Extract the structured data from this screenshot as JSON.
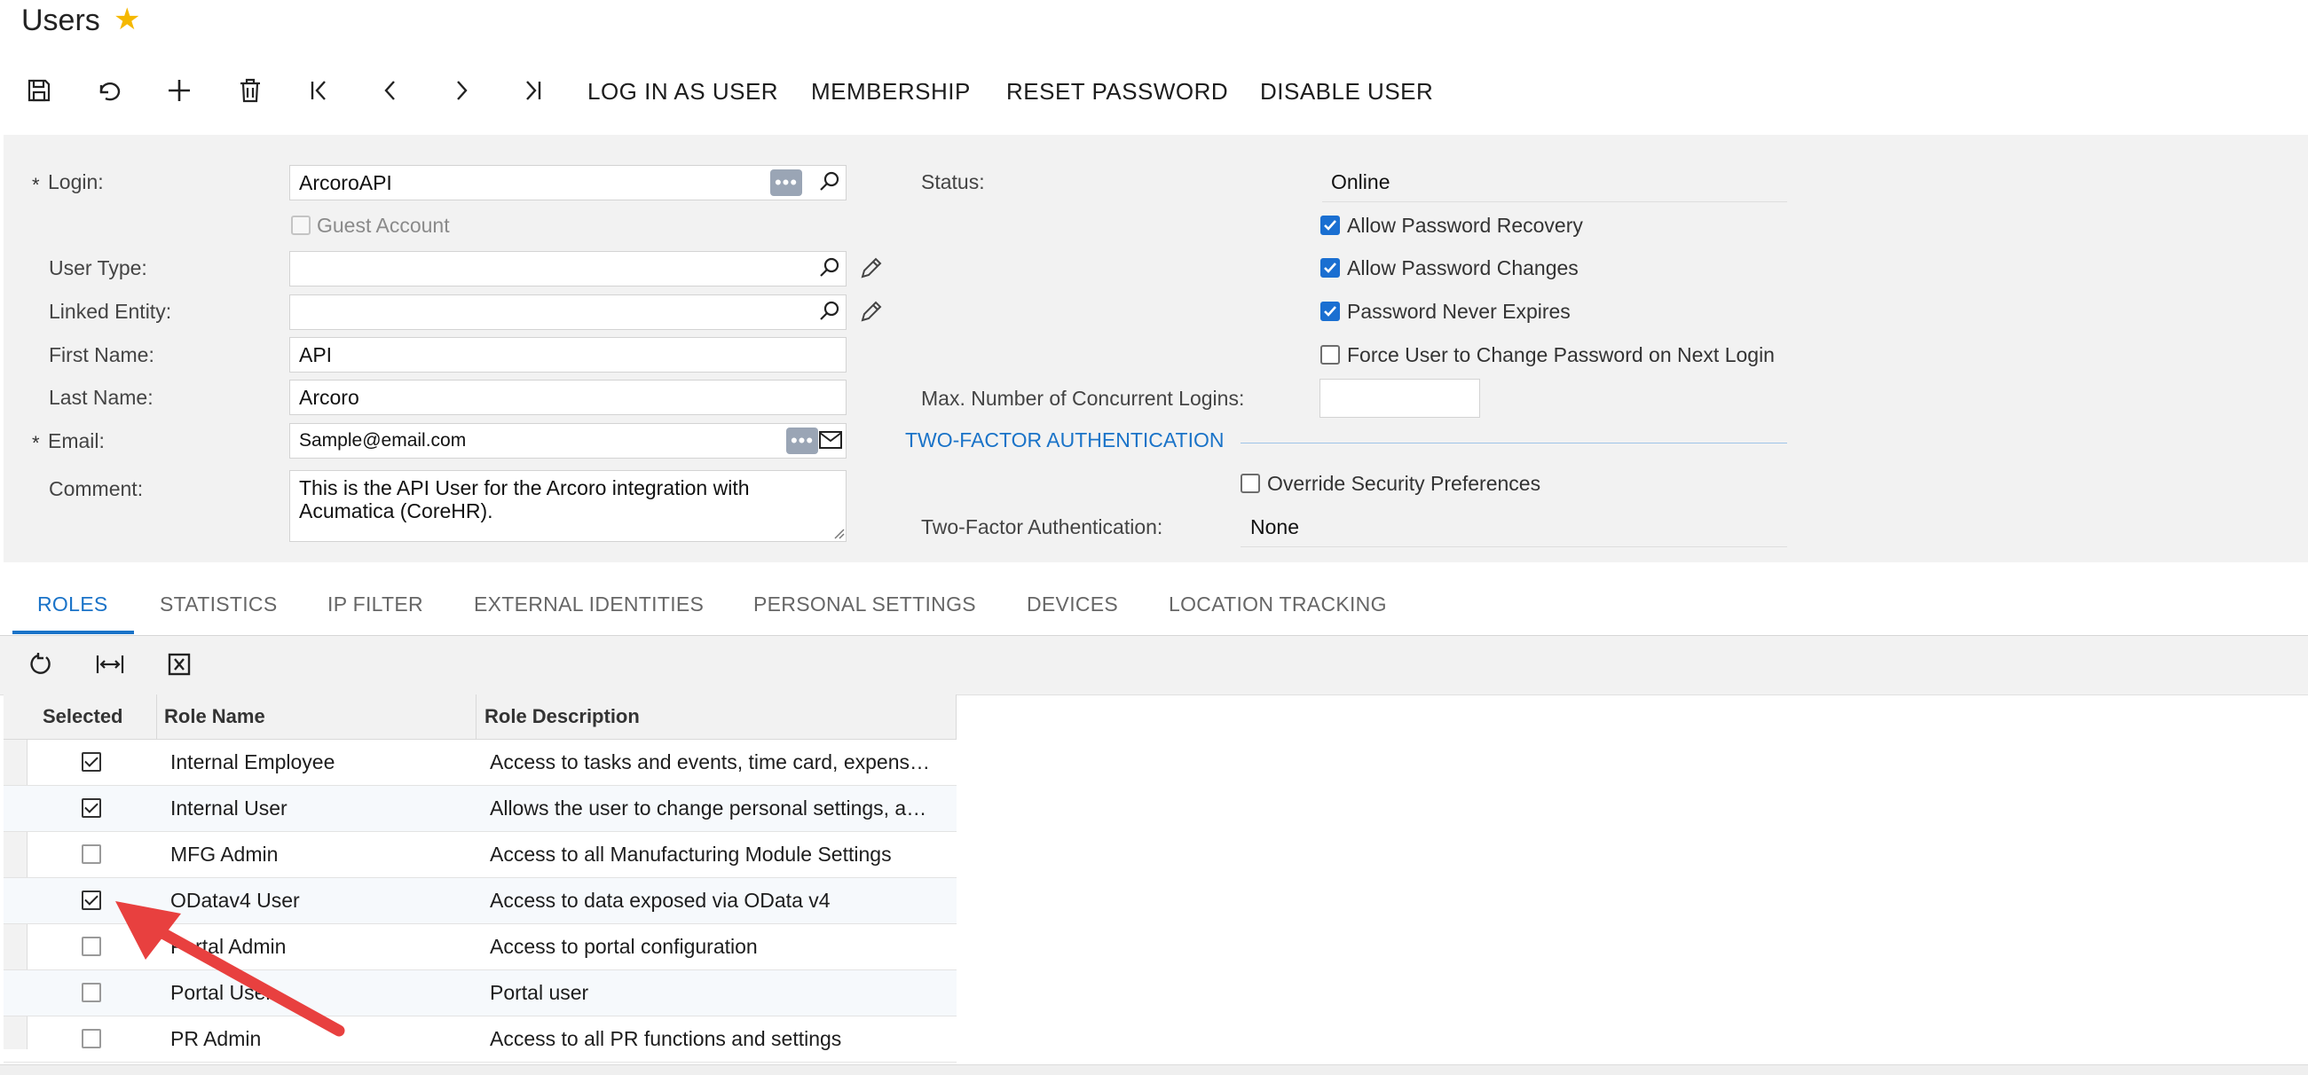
{
  "page": {
    "title": "Users"
  },
  "toolbar": {
    "actions": [
      "LOG IN AS USER",
      "MEMBERSHIP",
      "RESET PASSWORD",
      "DISABLE USER"
    ]
  },
  "form": {
    "login": {
      "label": "Login:",
      "value": "ArcoroAPI"
    },
    "guest_account": {
      "label": "Guest Account",
      "checked": false
    },
    "user_type": {
      "label": "User Type:",
      "value": ""
    },
    "linked_entity": {
      "label": "Linked Entity:",
      "value": ""
    },
    "first_name": {
      "label": "First Name:",
      "value": "API"
    },
    "last_name": {
      "label": "Last Name:",
      "value": "Arcoro"
    },
    "email": {
      "label": "Email:",
      "value": "Sample@email.com"
    },
    "comment": {
      "label": "Comment:",
      "value": "This is the API User for the Arcoro integration with Acumatica (CoreHR)."
    },
    "status": {
      "label": "Status:",
      "value": "Online"
    },
    "allow_password_recovery": {
      "label": "Allow Password Recovery",
      "checked": true
    },
    "allow_password_changes": {
      "label": "Allow Password Changes",
      "checked": true
    },
    "password_never_expires": {
      "label": "Password Never Expires",
      "checked": true
    },
    "force_change": {
      "label": "Force User to Change Password on Next Login",
      "checked": false
    },
    "max_logins": {
      "label": "Max. Number of Concurrent Logins:",
      "value": ""
    },
    "two_factor_section": "TWO-FACTOR AUTHENTICATION",
    "override_security": {
      "label": "Override Security Preferences",
      "checked": false
    },
    "two_factor": {
      "label": "Two-Factor Authentication:",
      "value": "None"
    }
  },
  "tabs": [
    "ROLES",
    "STATISTICS",
    "IP FILTER",
    "EXTERNAL IDENTITIES",
    "PERSONAL SETTINGS",
    "DEVICES",
    "LOCATION TRACKING"
  ],
  "active_tab": "ROLES",
  "grid": {
    "columns": [
      "Selected",
      "Role Name",
      "Role Description"
    ],
    "rows": [
      {
        "selected": true,
        "name": "Internal Employee",
        "description": "Access to tasks and events, time card, expens…"
      },
      {
        "selected": true,
        "name": "Internal User",
        "description": "Allows the user to change personal settings, a…"
      },
      {
        "selected": false,
        "name": "MFG Admin",
        "description": "Access to all Manufacturing Module Settings"
      },
      {
        "selected": true,
        "name": "ODatav4 User",
        "description": "Access to data exposed via OData v4"
      },
      {
        "selected": false,
        "name": "Portal Admin",
        "description": "Access to portal configuration"
      },
      {
        "selected": false,
        "name": "Portal User",
        "description": "Portal user"
      },
      {
        "selected": false,
        "name": "PR Admin",
        "description": "Access to all PR functions and settings"
      }
    ]
  },
  "colors": {
    "accent": "#1a73c8",
    "checkbox_on": "#1a6fd1",
    "annotation_arrow": "#e8403f",
    "form_bg": "#f2f2f2"
  }
}
